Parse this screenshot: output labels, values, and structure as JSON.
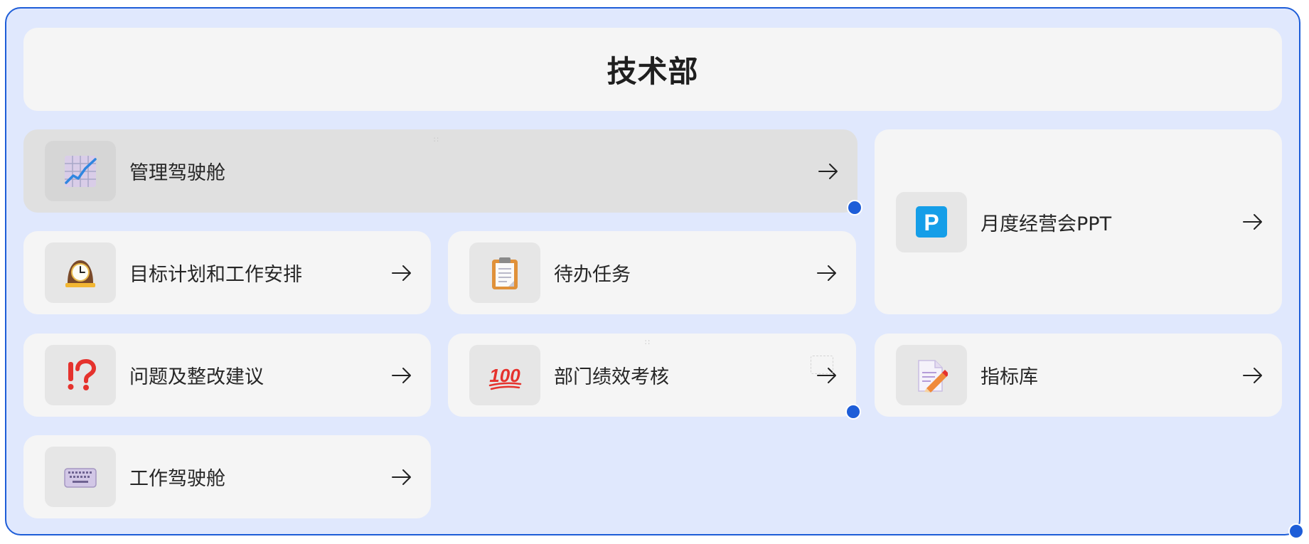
{
  "header": {
    "title": "技术部"
  },
  "cards": [
    {
      "label": "管理驾驶舱",
      "icon": "chart-increasing-icon",
      "selected": true
    },
    {
      "label": "月度经营会PPT",
      "icon": "p-button-icon"
    },
    {
      "label": "目标计划和工作安排",
      "icon": "mantelpiece-clock-icon"
    },
    {
      "label": "待办任务",
      "icon": "clipboard-icon"
    },
    {
      "label": "问题及整改建议",
      "icon": "exclamation-question-mark-icon"
    },
    {
      "label": "部门绩效考核",
      "icon": "hundred-points-icon",
      "icon_text": "100"
    },
    {
      "label": "指标库",
      "icon": "memo-icon"
    },
    {
      "label": "工作驾驶舱",
      "icon": "keyboard-icon"
    }
  ],
  "colors": {
    "board_background": "#e0e8fd",
    "board_border": "#1d5dd8",
    "card_background": "#f5f5f5",
    "selected_card_background": "#e0e0e0",
    "resize_handle": "#1d5dd8"
  }
}
